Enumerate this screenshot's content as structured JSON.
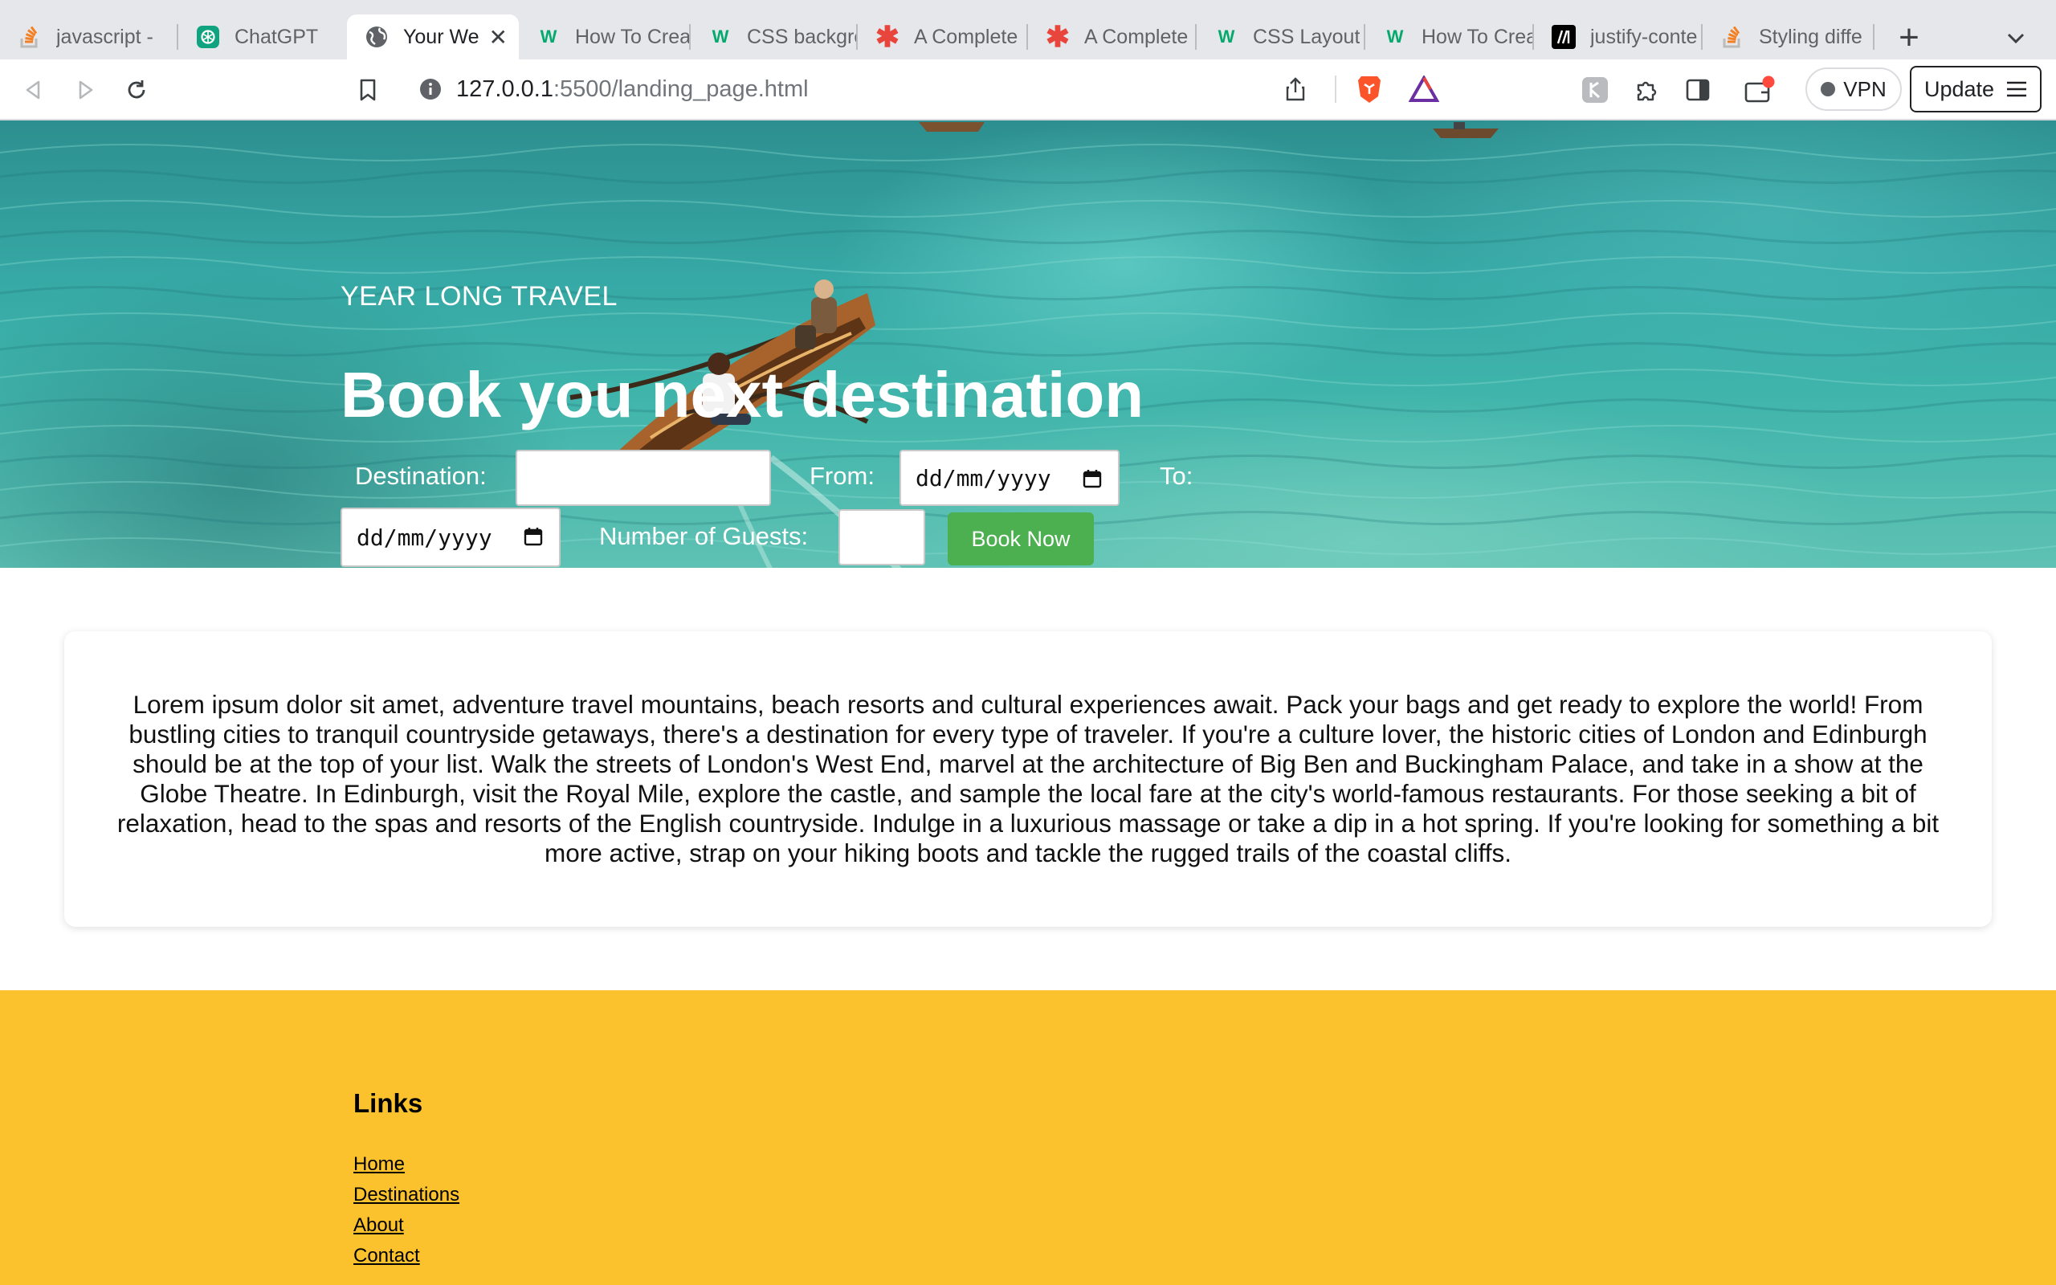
{
  "browser": {
    "tabs": [
      {
        "title": "javascript - ",
        "favicon": "stackoverflow-icon",
        "color": "#f48024"
      },
      {
        "title": "ChatGPT",
        "favicon": "chatgpt-icon",
        "color": "#10a37f"
      },
      {
        "title": "Your We",
        "favicon": "globe-icon",
        "color": "#5f6368"
      },
      {
        "title": "How To Crea",
        "favicon": "w3schools-icon",
        "color": "#04aa6d"
      },
      {
        "title": "CSS backgro",
        "favicon": "w3schools-icon",
        "color": "#04aa6d"
      },
      {
        "title": "A Complete",
        "favicon": "csstricks-icon",
        "color": "#e8453c"
      },
      {
        "title": "A Complete",
        "favicon": "csstricks-icon",
        "color": "#e8453c"
      },
      {
        "title": "CSS Layout",
        "favicon": "w3schools-icon",
        "color": "#04aa6d"
      },
      {
        "title": "How To Crea",
        "favicon": "w3schools-icon",
        "color": "#04aa6d"
      },
      {
        "title": "justify-conte",
        "favicon": "mdn-icon",
        "color": "#000000"
      },
      {
        "title": "Styling diffe",
        "favicon": "stackoverflow-icon",
        "color": "#f48024"
      }
    ],
    "url_host": "127.0.0.1",
    "url_path": ":5500/landing_page.html",
    "vpn_label": "VPN",
    "update_label": "Update"
  },
  "hero": {
    "tagline": "YEAR LONG TRAVEL",
    "title": "Book you next destination",
    "destination_label": "Destination:",
    "destination_value": "",
    "from_label": "From:",
    "from_placeholder": "dd/mm/yyyy",
    "to_label": "To:",
    "to_placeholder": "dd/mm/yyyy",
    "guests_label": "Number of Guests:",
    "guests_value": "",
    "book_button": "Book Now",
    "button_color": "#4caf50"
  },
  "content": {
    "paragraph": "Lorem ipsum dolor sit amet, adventure travel mountains, beach resorts and cultural experiences await. Pack your bags and get ready to explore the world! From bustling cities to tranquil countryside getaways, there's a destination for every type of traveler. If you're a culture lover, the historic cities of London and Edinburgh should be at the top of your list. Walk the streets of London's West End, marvel at the architecture of Big Ben and Buckingham Palace, and take in a show at the Globe Theatre. In Edinburgh, visit the Royal Mile, explore the castle, and sample the local fare at the city's world-famous restaurants. For those seeking a bit of relaxation, head to the spas and resorts of the English countryside. Indulge in a luxurious massage or take a dip in a hot spring. If you're looking for something a bit more active, strap on your hiking boots and tackle the rugged trails of the coastal cliffs."
  },
  "footer": {
    "heading": "Links",
    "links": [
      "Home",
      "Destinations",
      "About",
      "Contact"
    ],
    "background": "#fbc22d"
  }
}
